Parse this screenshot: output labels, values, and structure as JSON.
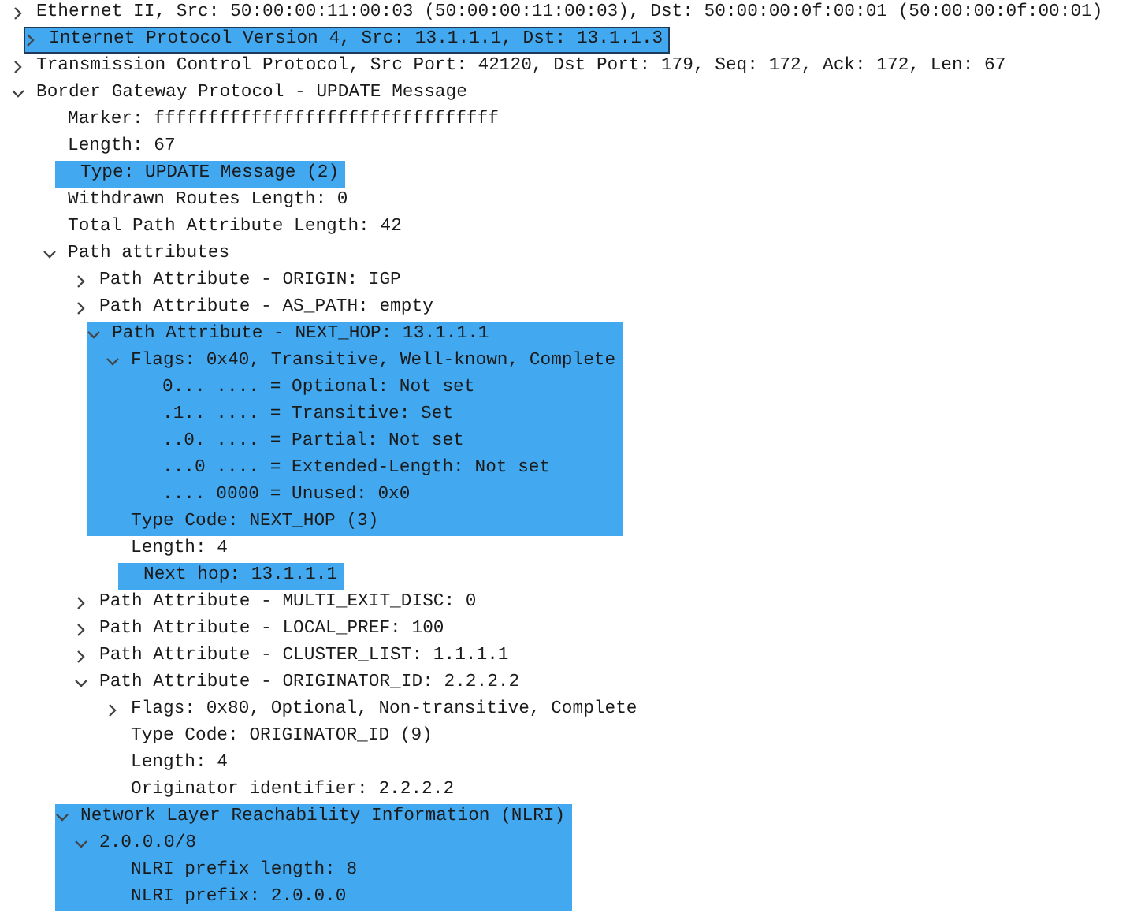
{
  "tree": [
    {
      "text": "Ethernet II, Src: 50:00:00:11:00:03 (50:00:00:11:00:03), Dst: 50:00:00:0f:00:01 (50:00:00:0f:00:01)",
      "selected": false,
      "highlighted": false,
      "expanded": false
    },
    {
      "text": "Internet Protocol Version 4, Src: 13.1.1.1, Dst: 13.1.1.3",
      "selected": true,
      "highlighted": true,
      "expanded": false
    },
    {
      "text": "Transmission Control Protocol, Src Port: 42120, Dst Port: 179, Seq: 172, Ack: 172, Len: 67",
      "selected": false,
      "highlighted": false,
      "expanded": false
    },
    {
      "text": "Border Gateway Protocol - UPDATE Message",
      "selected": false,
      "highlighted": false,
      "expanded": true,
      "children": [
        {
          "text": "Marker: ffffffffffffffffffffffffffffffff",
          "selected": false,
          "highlighted": false
        },
        {
          "text": "Length: 67",
          "selected": false,
          "highlighted": false
        },
        {
          "text": "Type: UPDATE Message (2)",
          "selected": false,
          "highlighted": true
        },
        {
          "text": "Withdrawn Routes Length: 0",
          "selected": false,
          "highlighted": false
        },
        {
          "text": "Total Path Attribute Length: 42",
          "selected": false,
          "highlighted": false
        },
        {
          "text": "Path attributes",
          "selected": false,
          "highlighted": false,
          "expanded": true,
          "children": [
            {
              "text": "Path Attribute - ORIGIN: IGP",
              "selected": false,
              "highlighted": false,
              "expanded": false
            },
            {
              "text": "Path Attribute - AS_PATH: empty",
              "selected": false,
              "highlighted": false,
              "expanded": false
            },
            {
              "text": "Path Attribute - NEXT_HOP: 13.1.1.1",
              "selected": false,
              "highlighted": true,
              "expanded": true,
              "children": [
                {
                  "text": "Flags: 0x40, Transitive, Well-known, Complete",
                  "selected": false,
                  "highlighted": true,
                  "expanded": true,
                  "children": [
                    {
                      "text": "0... .... = Optional: Not set",
                      "selected": false,
                      "highlighted": true
                    },
                    {
                      "text": ".1.. .... = Transitive: Set",
                      "selected": false,
                      "highlighted": true
                    },
                    {
                      "text": "..0. .... = Partial: Not set",
                      "selected": false,
                      "highlighted": true
                    },
                    {
                      "text": "...0 .... = Extended-Length: Not set",
                      "selected": false,
                      "highlighted": true
                    },
                    {
                      "text": ".... 0000 = Unused: 0x0",
                      "selected": false,
                      "highlighted": true
                    }
                  ]
                },
                {
                  "text": "Type Code: NEXT_HOP (3)",
                  "selected": false,
                  "highlighted": true
                },
                {
                  "text": "Length: 4",
                  "selected": false,
                  "highlighted": false
                },
                {
                  "text": "Next hop: 13.1.1.1",
                  "selected": false,
                  "highlighted": true
                }
              ]
            },
            {
              "text": "Path Attribute - MULTI_EXIT_DISC: 0",
              "selected": false,
              "highlighted": false,
              "expanded": false
            },
            {
              "text": "Path Attribute - LOCAL_PREF: 100",
              "selected": false,
              "highlighted": false,
              "expanded": false
            },
            {
              "text": "Path Attribute - CLUSTER_LIST: 1.1.1.1",
              "selected": false,
              "highlighted": false,
              "expanded": false
            },
            {
              "text": "Path Attribute - ORIGINATOR_ID: 2.2.2.2",
              "selected": false,
              "highlighted": false,
              "expanded": true,
              "children": [
                {
                  "text": "Flags: 0x80, Optional, Non-transitive, Complete",
                  "selected": false,
                  "highlighted": false,
                  "expanded": false
                },
                {
                  "text": "Type Code: ORIGINATOR_ID (9)",
                  "selected": false,
                  "highlighted": false
                },
                {
                  "text": "Length: 4",
                  "selected": false,
                  "highlighted": false
                },
                {
                  "text": "Originator identifier: 2.2.2.2",
                  "selected": false,
                  "highlighted": false
                }
              ]
            }
          ]
        },
        {
          "text": "Network Layer Reachability Information (NLRI)",
          "selected": false,
          "highlighted": true,
          "expanded": true,
          "children": [
            {
              "text": "2.0.0.0/8",
              "selected": false,
              "highlighted": true,
              "expanded": true,
              "children": [
                {
                  "text": "NLRI prefix length: 8",
                  "selected": false,
                  "highlighted": true
                },
                {
                  "text": "NLRI prefix: 2.0.0.0",
                  "selected": false,
                  "highlighted": true
                }
              ]
            }
          ]
        }
      ]
    }
  ]
}
